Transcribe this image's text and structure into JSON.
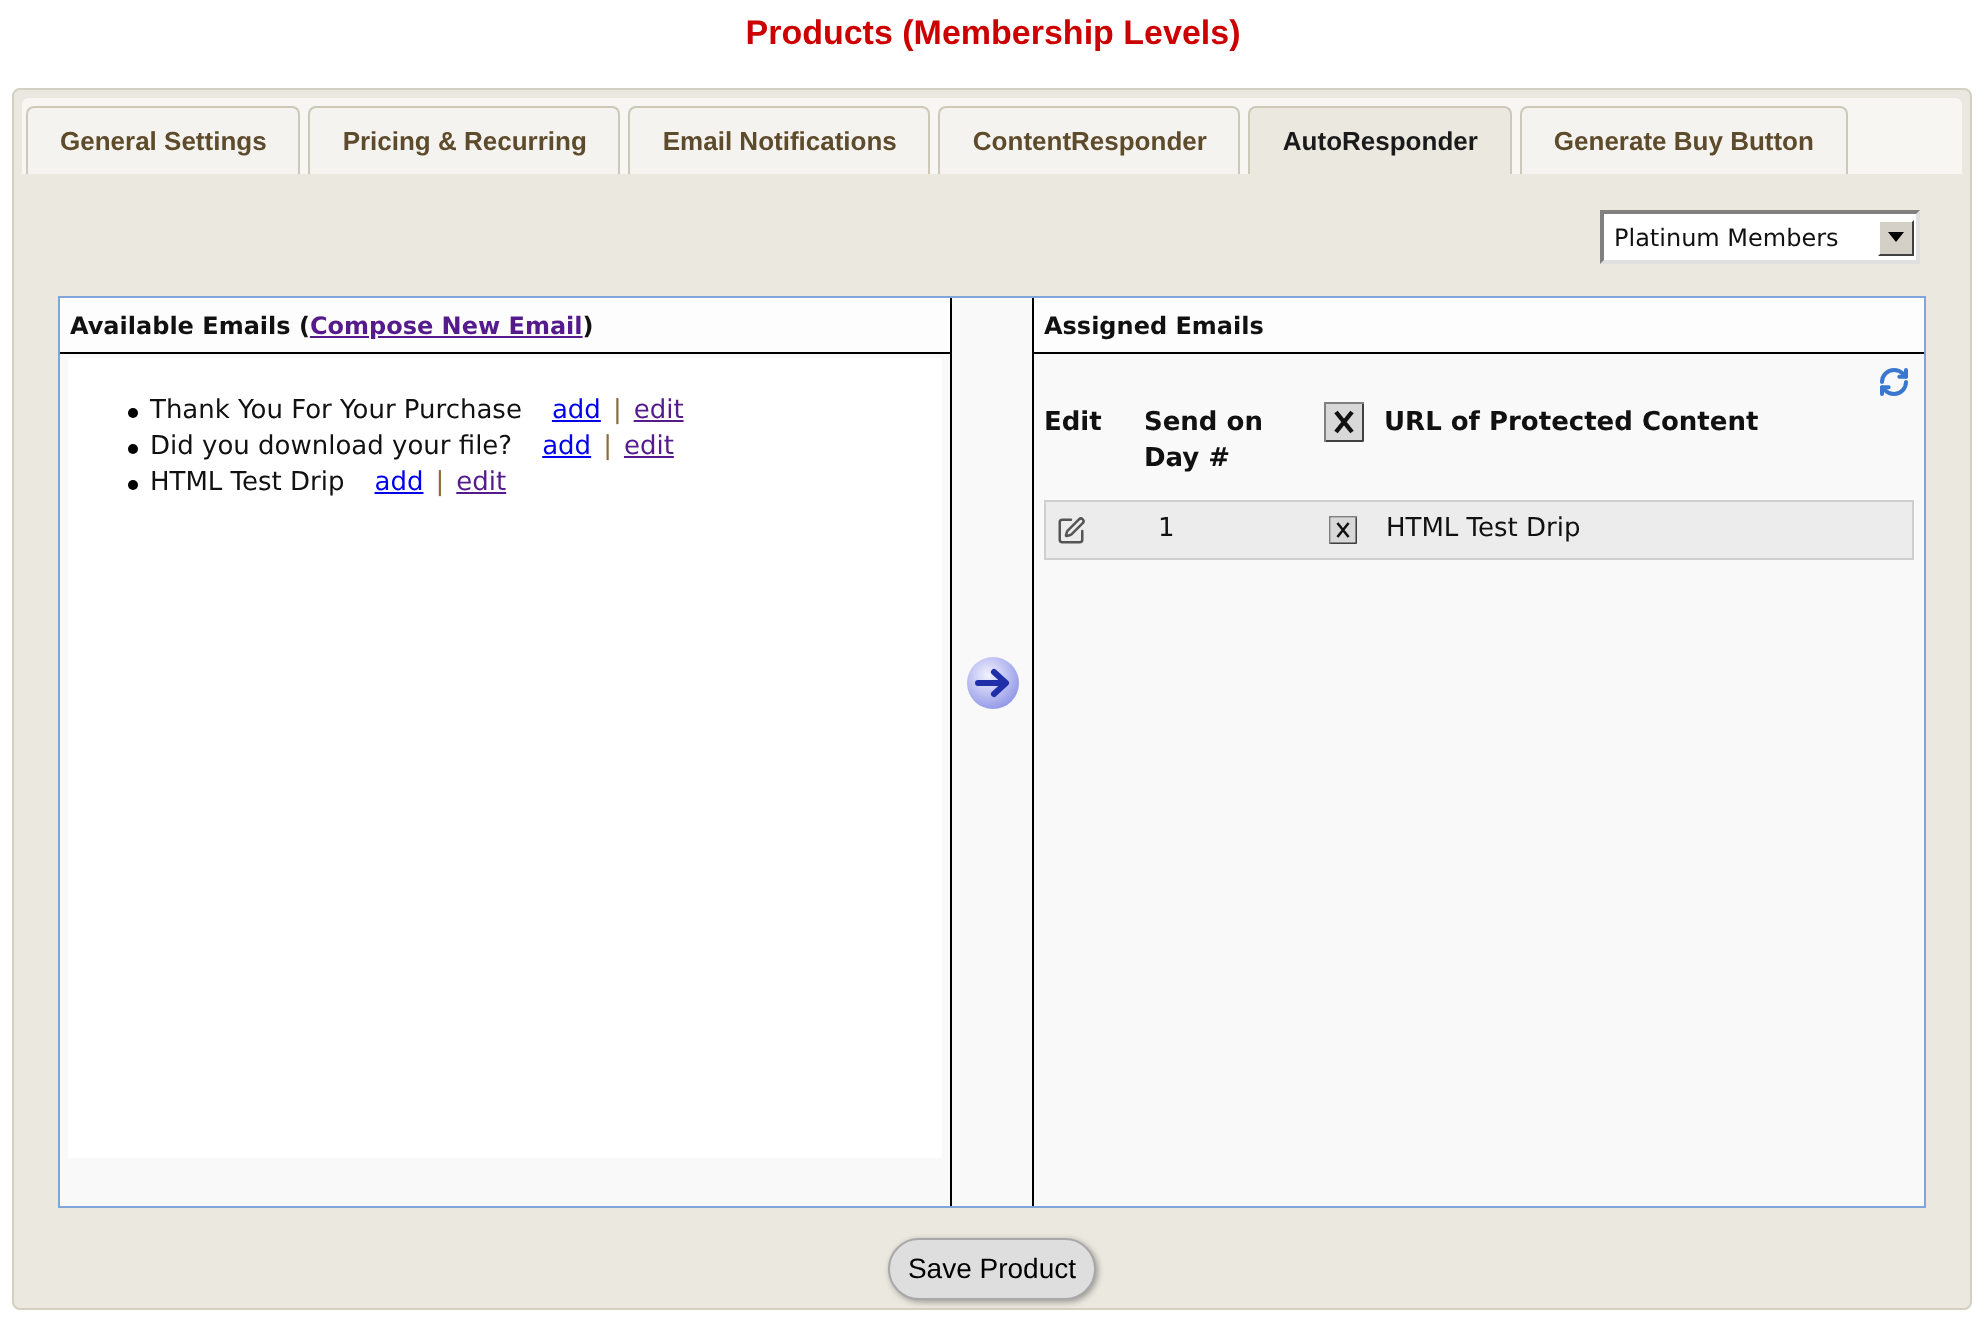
{
  "page_title": "Products (Membership Levels)",
  "tabs": [
    {
      "label": "General Settings",
      "selected": false
    },
    {
      "label": "Pricing & Recurring",
      "selected": false
    },
    {
      "label": "Email Notifications",
      "selected": false
    },
    {
      "label": "ContentResponder",
      "selected": false
    },
    {
      "label": "AutoResponder",
      "selected": true
    },
    {
      "label": "Generate Buy Button",
      "selected": false
    }
  ],
  "membership_select": {
    "value": "Platinum Members"
  },
  "available_emails": {
    "title_before": "Available Emails (",
    "compose_link": {
      "label": "Compose New Email",
      "visited": true
    },
    "title_after": ")",
    "items": [
      {
        "name": "Thank You For Your Purchase",
        "add": {
          "label": "add",
          "visited": false
        },
        "separator": "|",
        "edit": {
          "label": "edit",
          "visited": true
        }
      },
      {
        "name": "Did you download your file?",
        "add": {
          "label": "add",
          "visited": false
        },
        "separator": "|",
        "edit": {
          "label": "edit",
          "visited": true
        }
      },
      {
        "name": "HTML Test Drip",
        "add": {
          "label": "add",
          "visited": false
        },
        "separator": "|",
        "edit": {
          "label": "edit",
          "visited": true
        }
      }
    ]
  },
  "assigned_emails": {
    "title": "Assigned Emails",
    "columns": [
      {
        "kind": "text",
        "label": "Edit"
      },
      {
        "kind": "text",
        "label": "Send on Day #"
      },
      {
        "kind": "delete"
      },
      {
        "kind": "text",
        "label": "URL of Protected Content"
      }
    ],
    "rows": [
      {
        "day": "1",
        "url": "HTML Test Drip"
      }
    ]
  },
  "save_button": "Save Product"
}
